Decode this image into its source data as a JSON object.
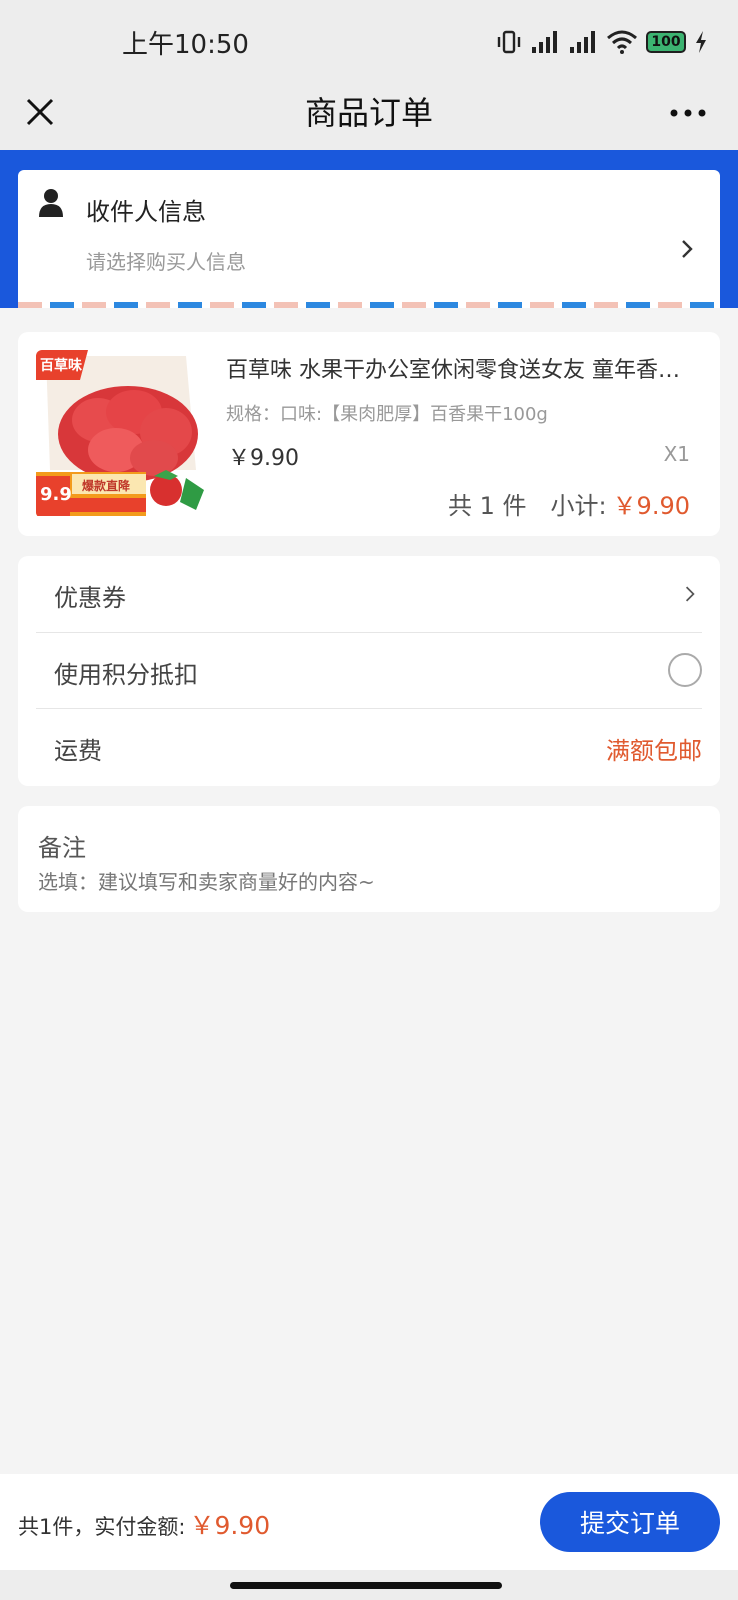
{
  "status_bar": {
    "time": "上午10:50",
    "battery": "100",
    "icons": [
      "vibrate-icon",
      "signal-icon",
      "signal-icon",
      "wifi-icon",
      "battery-icon",
      "charging-icon"
    ]
  },
  "nav": {
    "title": "商品订单",
    "close_icon": "close-icon",
    "more_icon": "more-icon"
  },
  "recipient": {
    "title": "收件人信息",
    "subtitle": "请选择购买人信息",
    "icon": "person-icon"
  },
  "product": {
    "image_brand": "百草味",
    "image_badge_price": "9.9",
    "image_badge_text": "爆款直降",
    "name": "百草味 水果干办公室休闲零食送女友 童年香甜草莓干脯",
    "spec": "规格：口味:【果肉肥厚】百香果干100g",
    "price": "￥9.90",
    "quantity": "X1",
    "count_label": "共 1 件",
    "subtotal_label": "小计:",
    "subtotal_value": "￥9.90"
  },
  "options": {
    "coupon_label": "优惠券",
    "points_label": "使用积分抵扣",
    "points_enabled": false,
    "shipping_label": "运费",
    "shipping_value": "满额包邮"
  },
  "note": {
    "title": "备注",
    "placeholder": "选填：建议填写和卖家商量好的内容~"
  },
  "footer": {
    "total_label": "共1件，实付金额:",
    "total_value": "￥9.90",
    "submit_label": "提交订单"
  },
  "colors": {
    "accent_blue": "#1a58dc",
    "price_red": "#e05a2f"
  }
}
